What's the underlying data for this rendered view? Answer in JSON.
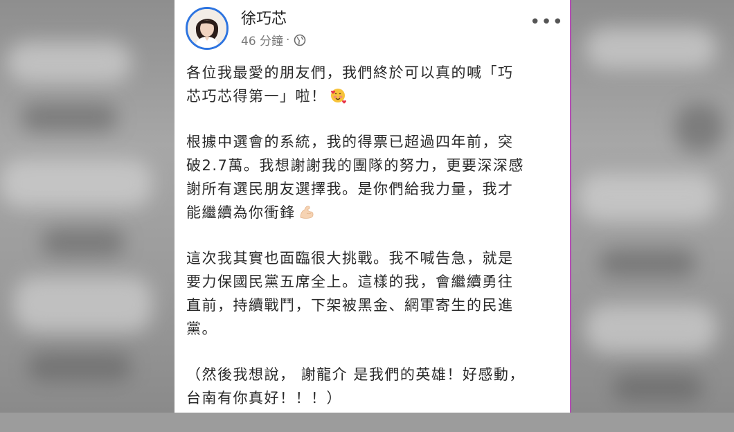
{
  "post": {
    "author_name": "徐巧芯",
    "timestamp": "46 分鐘",
    "meta_separator": "·",
    "privacy_icon": "globe-icon",
    "more_options_icon": "more-options-icon",
    "more_label": "•••",
    "paragraphs": [
      {
        "lines": [
          "各位我最愛的朋友們，我們終於可以真的喊「巧",
          "芯巧芯得第一」啦！"
        ],
        "emoji": "smiling-face-with-hearts-emoji"
      },
      {
        "lines": [
          "根據中選會的系統，我的得票已超過四年前，突",
          "破2.7萬。我想謝謝我的團隊的努力，更要深深感",
          "謝所有選民朋友選擇我。是你們給我力量，我才",
          "能繼續為你衝鋒"
        ],
        "emoji": "flexed-biceps-emoji"
      },
      {
        "lines": [
          "這次我其實也面臨很大挑戰。我不喊告急，就是",
          "要力保國民黨五席全上。這樣的我，會繼續勇往",
          "直前，持續戰鬥，下架被黑金、網軍寄生的民進",
          "黨。"
        ]
      },
      {
        "lines": [
          "（然後我想說， 謝龍介 是我們的英雄！好感動，",
          "台南有你真好！！！）"
        ]
      }
    ]
  }
}
